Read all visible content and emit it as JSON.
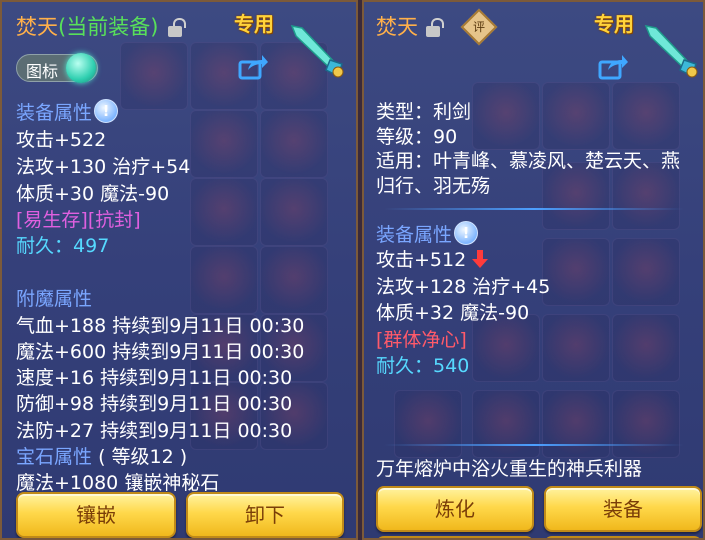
{
  "left_panel": {
    "title_name": "焚天",
    "title_tag": "(当前装备)",
    "exclusive_label": "专用",
    "icon_toggle_label": "图标",
    "attr_title": "装备属性",
    "attrs": [
      "攻击+522",
      "法攻+130 治疗+54",
      "体质+30 魔法-90"
    ],
    "special": "[易生存][抗封]",
    "durability_label": "耐久：",
    "durability_value": "497",
    "enchant_title": "附魔属性",
    "enchants": [
      "气血+188 持续到9月11日 00:30",
      "魔法+600 持续到9月11日 00:30",
      "速度+16 持续到9月11日 00:30",
      "防御+98 持续到9月11日 00:30",
      "法防+27 持续到9月11日 00:30"
    ],
    "gem_title": "宝石属性",
    "gem_level": "( 等级12 )",
    "gem_line": "魔法+1080 镶嵌神秘石",
    "buttons": {
      "inlay": "镶嵌",
      "unequip": "卸下"
    }
  },
  "right_panel": {
    "title_name": "焚天",
    "seal_text": "评",
    "exclusive_label": "专用",
    "type_line": "类型：利剑",
    "level_line": "等级：90",
    "fit_line1": "适用：叶青峰、慕凌风、楚云天、燕",
    "fit_line2": "归行、羽无殇",
    "attr_title": "装备属性",
    "attrs": [
      "攻击+512",
      "法攻+128 治疗+45",
      "体质+32 魔法-90"
    ],
    "special": "[群体净心]",
    "durability_label": "耐久：",
    "durability_value": "540",
    "description": "万年熔炉中浴火重生的神兵利器",
    "buttons": {
      "refine": "炼化",
      "equip": "装备"
    }
  }
}
